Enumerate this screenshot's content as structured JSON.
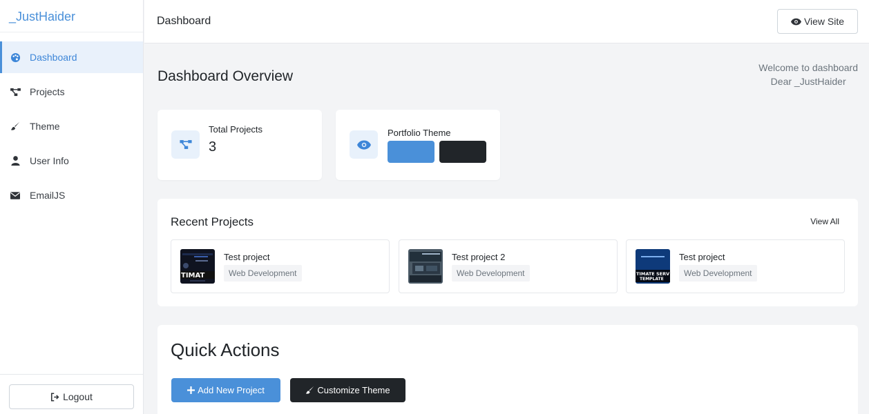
{
  "brand": "_JustHaider",
  "sidebar": {
    "items": [
      {
        "label": "Dashboard",
        "icon": "palette-icon",
        "active": true
      },
      {
        "label": "Projects",
        "icon": "project-diagram-icon"
      },
      {
        "label": "Theme",
        "icon": "paintbrush-icon"
      },
      {
        "label": "User Info",
        "icon": "user-icon"
      },
      {
        "label": "EmailJS",
        "icon": "envelope-icon"
      }
    ],
    "logout_label": "Logout"
  },
  "topbar": {
    "title": "Dashboard",
    "view_site_label": "View Site"
  },
  "overview": {
    "title": "Dashboard Overview",
    "welcome_line1": "Welcome to dashboard",
    "welcome_line2": "Dear _JustHaider"
  },
  "stats": {
    "total_projects_label": "Total Projects",
    "total_projects_value": "3",
    "portfolio_theme_label": "Portfolio Theme",
    "theme_colors": [
      "#4a90d9",
      "#212529"
    ]
  },
  "recent": {
    "title": "Recent Projects",
    "view_all_label": "View All",
    "projects": [
      {
        "name": "Test project",
        "category": "Web Development"
      },
      {
        "name": "Test project 2",
        "category": "Web Development"
      },
      {
        "name": "Test project",
        "category": "Web Development"
      }
    ]
  },
  "quick_actions": {
    "title": "Quick Actions",
    "add_label": "Add New Project",
    "customize_label": "Customize Theme"
  },
  "colors": {
    "accent": "#4a90d9",
    "dark": "#212529"
  }
}
